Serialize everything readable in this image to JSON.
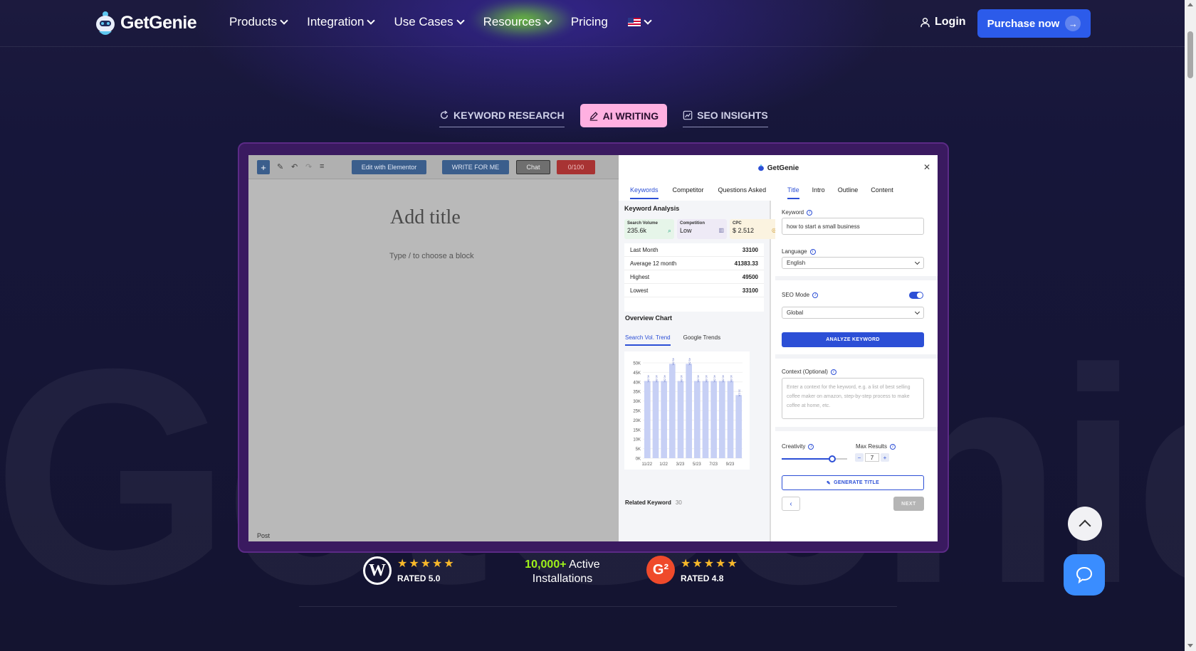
{
  "brand": {
    "name": "GetGenie"
  },
  "nav": {
    "items": [
      {
        "label": "Products",
        "dropdown": true
      },
      {
        "label": "Integration",
        "dropdown": true
      },
      {
        "label": "Use Cases",
        "dropdown": true
      },
      {
        "label": "Resources",
        "dropdown": true
      },
      {
        "label": "Pricing",
        "dropdown": false
      }
    ],
    "login": "Login",
    "purchase": "Purchase now"
  },
  "feature_tabs": [
    {
      "label": "KEYWORD RESEARCH",
      "active": false
    },
    {
      "label": "AI WRITING",
      "active": true
    },
    {
      "label": "SEO INSIGHTS",
      "active": false
    }
  ],
  "background_word": "GetGenie",
  "editor": {
    "edit_elementor": "Edit with Elementor",
    "write_for_me": "WRITE FOR ME",
    "chat": "Chat",
    "counter": "0/100",
    "title_placeholder": "Add title",
    "block_hint": "Type / to choose a block",
    "post_label": "Post"
  },
  "panel": {
    "title": "GetGenie",
    "left_tabs": [
      "Keywords",
      "Competitor",
      "Questions Asked"
    ],
    "right_tabs": [
      "Title",
      "Intro",
      "Outline",
      "Content"
    ],
    "keyword_analysis": "Keyword Analysis",
    "metrics": [
      {
        "label": "Search Volume",
        "value": "235.6k",
        "color": "#e6f5e9"
      },
      {
        "label": "Competition",
        "value": "Low",
        "color": "#eeeaf6"
      },
      {
        "label": "CPC",
        "value": "$ 2.512",
        "color": "#fbf3e0"
      }
    ],
    "stats": [
      {
        "label": "Last Month",
        "value": "33100"
      },
      {
        "label": "Average 12 month",
        "value": "41383.33"
      },
      {
        "label": "Highest",
        "value": "49500"
      },
      {
        "label": "Lowest",
        "value": "33100"
      }
    ],
    "overview_chart": "Overview Chart",
    "chart_tabs": [
      "Search Vol. Trend",
      "Google Trends"
    ],
    "related_keyword": "Related Keyword",
    "related_count": "30",
    "form": {
      "keyword_label": "Keyword",
      "keyword_value": "how to start a small business",
      "language_label": "Language",
      "language_value": "English",
      "seo_mode_label": "SEO Mode",
      "seo_mode_on": true,
      "region_value": "Global",
      "analyze_button": "ANALYZE KEYWORD",
      "context_label": "Context (Optional)",
      "context_placeholder": "Enter a context for the keyword, e.g. a list of best selling coffee maker on amazon, step-by-step process to make coffee at home, etc.",
      "creativity_label": "Creativity",
      "creativity_level": 0.75,
      "max_results_label": "Max Results",
      "max_results_value": "7",
      "generate_button": "GENERATE TITLE",
      "next_button": "NEXT"
    }
  },
  "chart_data": {
    "type": "bar",
    "categories": [
      "11/22",
      "12/22",
      "1/23",
      "2/23",
      "3/23",
      "4/23",
      "5/23",
      "6/23",
      "7/23",
      "8/23",
      "9/23",
      "10/23"
    ],
    "x_tick_labels": [
      "11/22",
      "1/22",
      "3/23",
      "5/23",
      "7/23",
      "9/23"
    ],
    "values": [
      40500,
      40500,
      40500,
      49500,
      40500,
      49500,
      40500,
      40500,
      40500,
      40500,
      40500,
      33100
    ],
    "value_labels": [
      "40.5K",
      "40.5K",
      "40.5K",
      "49.5K",
      "40.5K",
      "49.5K",
      "40.5K",
      "40.5K",
      "40.5K",
      "40.5K",
      "40.5K",
      "33.1K"
    ],
    "y_ticks": [
      "0K",
      "5K",
      "10K",
      "15K",
      "20K",
      "25K",
      "30K",
      "35K",
      "40K",
      "45K",
      "50K"
    ],
    "ylim": [
      0,
      50000
    ],
    "bar_color": "#c7d0f5"
  },
  "ratings": {
    "wordpress_rating": "RATED 5.0",
    "wordpress_stars": 5,
    "installs_highlight": "10,000+",
    "installs_text1": "Active",
    "installs_text2": "Installations",
    "g2_rating": "RATED 4.8",
    "g2_stars": 4.8
  }
}
